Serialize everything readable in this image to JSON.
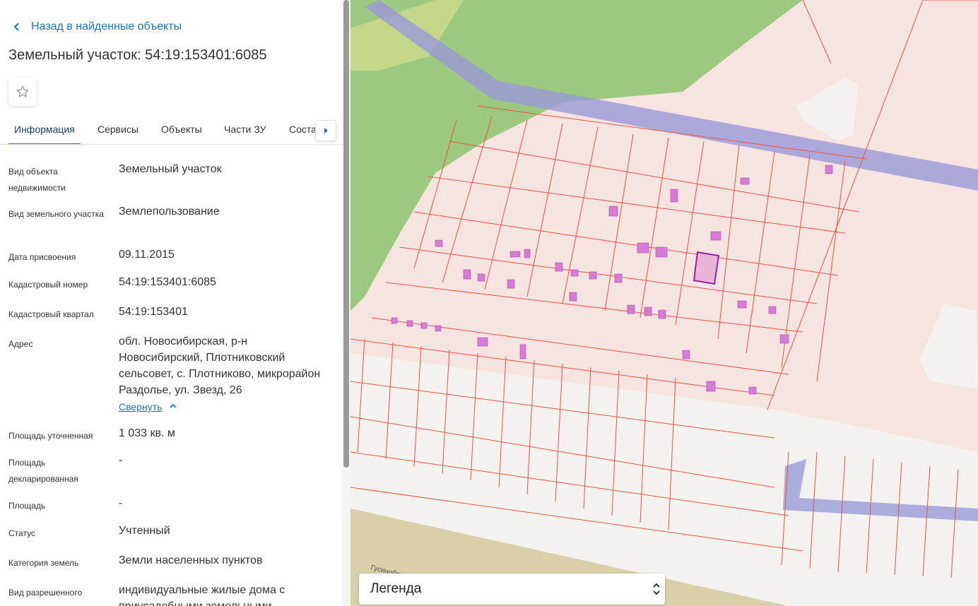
{
  "panel": {
    "back_label": "Назад в найденные объекты",
    "title": "Земельный участок: 54:19:153401:6085",
    "tabs": [
      {
        "label": "Информация",
        "active": true
      },
      {
        "label": "Сервисы",
        "active": false
      },
      {
        "label": "Объекты",
        "active": false
      },
      {
        "label": "Части ЗУ",
        "active": false
      },
      {
        "label": "Соста",
        "active": false
      }
    ],
    "fields": [
      {
        "key": "Вид объекта недвижимости",
        "value": "Земельный участок"
      },
      {
        "key": "Вид земельного участка",
        "value": "Землепользование"
      },
      {
        "key": "Дата присвоения",
        "value": "09.11.2015"
      },
      {
        "key": "Кадастровый номер",
        "value": "54:19:153401:6085"
      },
      {
        "key": "Кадастровый квартал",
        "value": "54:19:153401"
      },
      {
        "key": "Адрес",
        "value": "обл. Новосибирская, р-н Новосибирский, Плотниковский сельсовет, с. Плотниково, микрорайон Раздолье, ул. Звезд, 26"
      },
      {
        "key": "Площадь уточненная",
        "value": "1 033 кв. м"
      },
      {
        "key": "Площадь декларированная",
        "value": "-"
      },
      {
        "key": "Площадь",
        "value": "-"
      },
      {
        "key": "Статус",
        "value": "Учтенный"
      },
      {
        "key": "Категория земель",
        "value": "Земли населенных пунктов"
      },
      {
        "key": "Вид разрешенного",
        "value": "индивидуальные жилые дома с приусадебными земельными"
      }
    ],
    "collapse_label": "Свернуть"
  },
  "map": {
    "legend_label": "Легенда",
    "street_label": "Гусинобро",
    "colors": {
      "parcel_fill": "#f5e4e0",
      "parcel_line": "#e8543a",
      "forest": "#9cc97f",
      "road_blue": "#9a9ad8",
      "building": "#d77ad8",
      "selected": "#9a1fa8"
    }
  },
  "icons": {
    "back": "chevron-left-icon",
    "favorite": "star-outline-icon",
    "tab_scroll": "chevron-right-icon",
    "collapse": "chevron-up-icon",
    "legend": "updown-icon"
  }
}
